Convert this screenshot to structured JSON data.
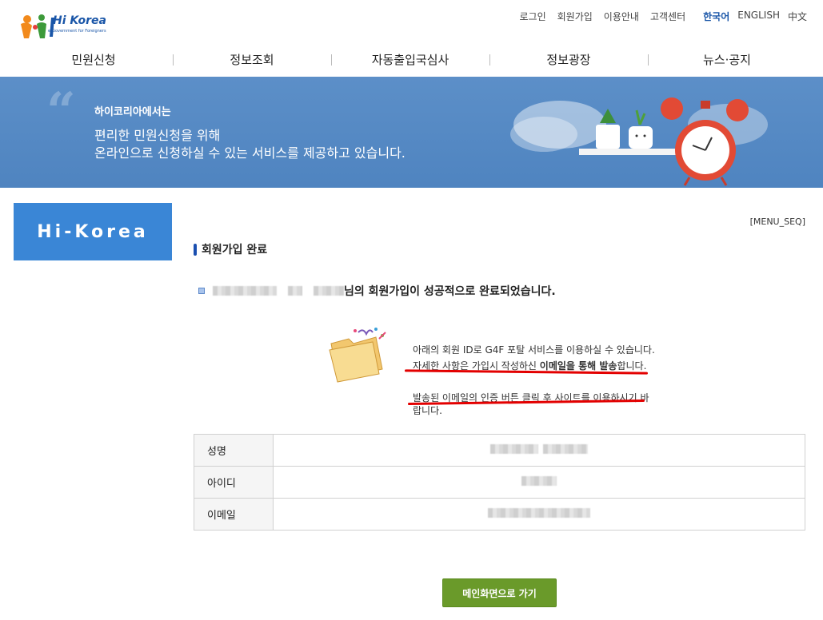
{
  "logo": {
    "text": "Hi Korea",
    "subtitle": "e-Government for Foreigners"
  },
  "util_nav": {
    "links": [
      "로그인",
      "회원가입",
      "이용안내",
      "고객센터"
    ],
    "languages": [
      "한국어",
      "ENGLISH",
      "中文"
    ]
  },
  "gnb": [
    "민원신청",
    "정보조회",
    "자동출입국심사",
    "정보광장",
    "뉴스·공지"
  ],
  "banner": {
    "title": "하이코리아에서는",
    "line1": "편리한 민원신청을 위해",
    "line2": "온라인으로 신청하실 수 있는 서비스를 제공하고 있습니다."
  },
  "side_box": {
    "label": "Hi-Korea"
  },
  "menu_seq": "[MENU_SEQ]",
  "section_title": "회원가입 완료",
  "success_message": "님의 회원가입이 성공적으로 완료되었습니다.",
  "info": {
    "line1": "아래의 회원 ID로 G4F 포탈 서비스를 이용하실 수 있습니다.",
    "line2_pre": "자세한 사항은 가입시 작성하신 ",
    "line2_bold": "이메일을 통해 발송",
    "line2_post": "합니다.",
    "line3": "발송된 이메일의 인증 버튼 클릭 후 사이트를 이용하시기 바",
    "line4": "랍니다."
  },
  "table": {
    "rows": [
      {
        "label": "성명"
      },
      {
        "label": "아이디"
      },
      {
        "label": "이메일"
      }
    ]
  },
  "main_button": "메인화면으로 가기",
  "colors": {
    "banner": "#4f84c0",
    "side_box": "#3a86d6",
    "button": "#6a9a2a",
    "underline": "#e30000"
  }
}
